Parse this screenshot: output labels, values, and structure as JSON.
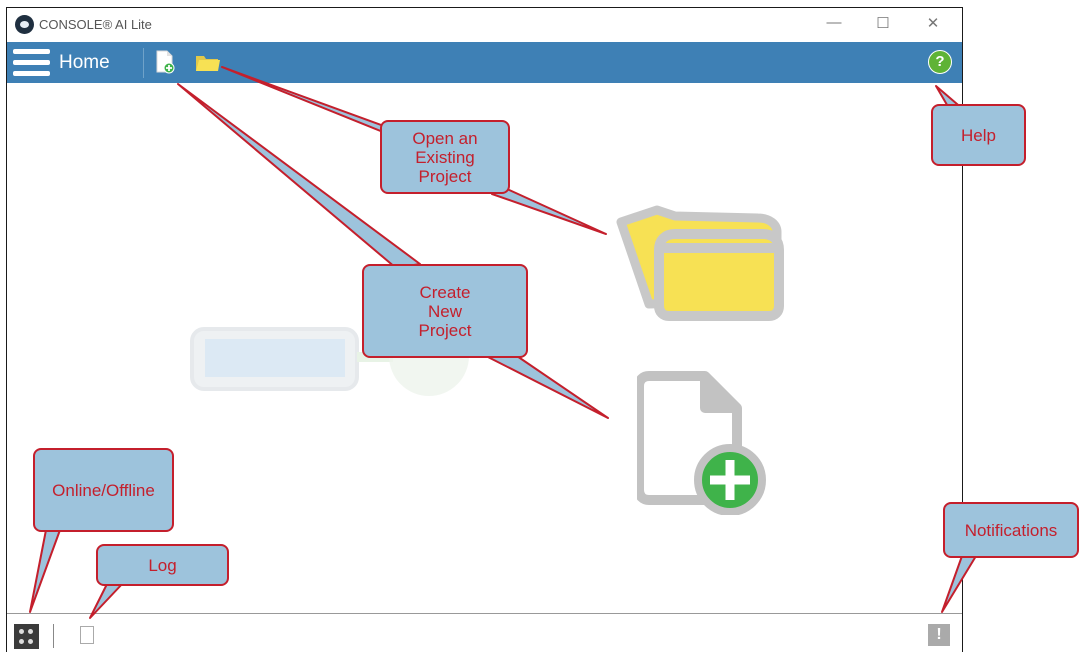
{
  "window": {
    "title": "CONSOLE® AI Lite",
    "controls": {
      "minimize": "—",
      "maximize": "☐",
      "close": "✕"
    }
  },
  "toolbar": {
    "menu_icon": "hamburger-icon",
    "home_label": "Home",
    "new_project_icon": "new-file-icon",
    "open_project_icon": "open-folder-icon",
    "help_symbol": "?"
  },
  "statusbar": {
    "online_icon": "online-offline-icon",
    "log_icon": "log-icon",
    "notifications_symbol": "!"
  },
  "callouts": {
    "open_project": "Open an\nExisting\nProject",
    "create_project": "Create\nNew\nProject",
    "help": "Help",
    "online_offline": "Online/Offline",
    "log": "Log",
    "notifications": "Notifications"
  },
  "colors": {
    "toolbar": "#3e80b5",
    "callout_fill": "#9dc3dc",
    "callout_border": "#c41f2c",
    "folder_yellow": "#f7e154",
    "add_green": "#3fb34a"
  }
}
